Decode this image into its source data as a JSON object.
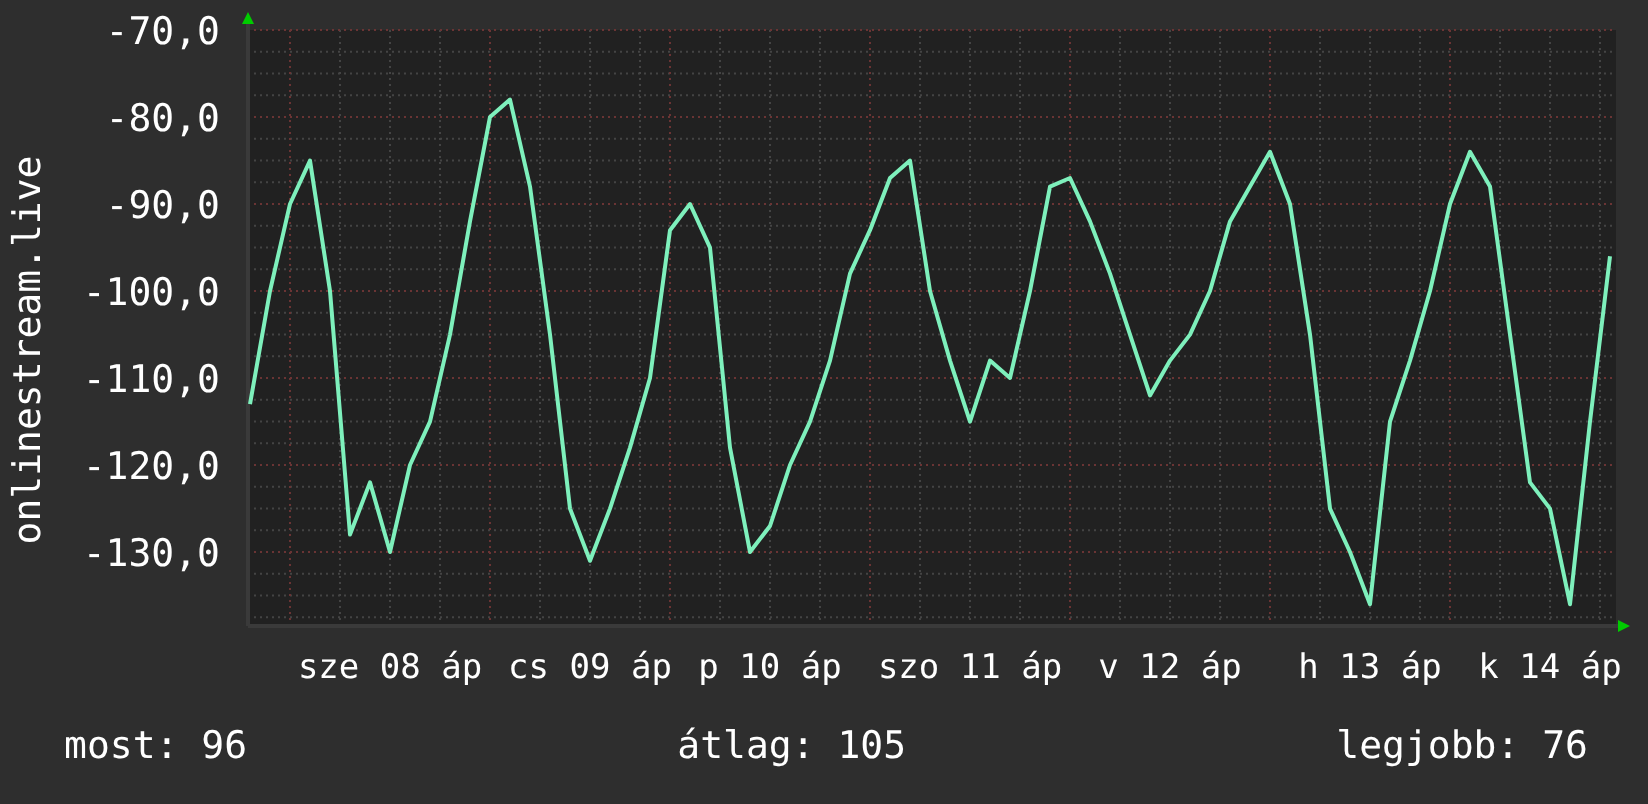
{
  "chart": {
    "chart_data": {
      "type": "line",
      "ylabel": "onlinestream.live",
      "grid": true,
      "categories": [
        null,
        null,
        null,
        null,
        null,
        null,
        null,
        "sze 08 áp",
        null,
        null,
        null,
        null,
        null,
        null,
        null,
        null,
        null,
        "cs 09 áp",
        null,
        null,
        null,
        null,
        null,
        null,
        null,
        null,
        "p 10 áp",
        null,
        null,
        null,
        null,
        null,
        null,
        null,
        null,
        null,
        "szo 11 áp",
        null,
        null,
        null,
        null,
        null,
        null,
        null,
        null,
        null,
        "v 12 áp",
        null,
        null,
        null,
        null,
        null,
        null,
        null,
        null,
        null,
        "h 13 áp",
        null,
        null,
        null,
        null,
        null,
        null,
        null,
        null,
        "k 14 áp",
        null,
        null,
        null
      ],
      "series": [
        {
          "color": "#7ef0bc",
          "values": [
            -113,
            -100,
            -90,
            -85,
            -100,
            -128,
            -122,
            -130,
            -120,
            -115,
            -105,
            -92,
            -80,
            -78,
            -88,
            -105,
            -125,
            -131,
            -125,
            -118,
            -110,
            -93,
            -90,
            -95,
            -118,
            -130,
            -127,
            -120,
            -115,
            -108,
            -98,
            -93,
            -87,
            -85,
            -100,
            -108,
            -115,
            -108,
            -110,
            -100,
            -88,
            -87,
            -92,
            -98,
            -105,
            -112,
            -108,
            -105,
            -100,
            -92,
            -88,
            -84,
            -90,
            -105,
            -125,
            -130,
            -136,
            -115,
            -108,
            -100,
            -90,
            -84,
            -88,
            -105,
            -122,
            -125,
            -136,
            -115,
            -96
          ]
        }
      ],
      "ylim": [
        -138.5,
        -70
      ],
      "yticks": [
        {
          "value": -70,
          "label": "-70,0"
        },
        {
          "value": -80,
          "label": "-80,0"
        },
        {
          "value": -90,
          "label": "-90,0"
        },
        {
          "value": -100,
          "label": "-100,0"
        },
        {
          "value": -110,
          "label": "-110,0"
        },
        {
          "value": -120,
          "label": "-120,0"
        },
        {
          "value": -130,
          "label": "-130,0"
        }
      ]
    }
  },
  "legend": [
    {
      "label": "most: 96"
    },
    {
      "label": "átlag: 105"
    },
    {
      "label": "legjobb: 76"
    }
  ]
}
